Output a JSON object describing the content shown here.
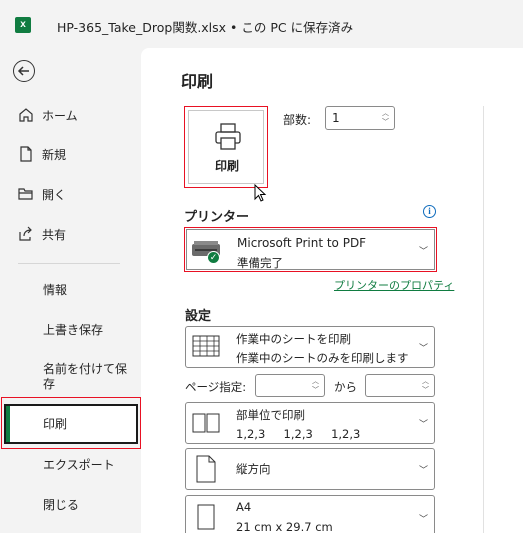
{
  "titlebar": {
    "app_icon": "excel-icon",
    "app_icon_letter": "x",
    "title": "HP-365_Take_Drop関数.xlsx • この PC に保存済み"
  },
  "sidebar": {
    "back_icon": "back-arrow-icon",
    "items": [
      {
        "label": "ホーム",
        "icon": "home-icon"
      },
      {
        "label": "新規",
        "icon": "new-file-icon"
      },
      {
        "label": "開く",
        "icon": "folder-icon"
      },
      {
        "label": "共有",
        "icon": "share-icon"
      }
    ],
    "plain_items": [
      "情報",
      "上書き保存",
      "名前を付けて保存",
      "印刷",
      "エクスポート",
      "閉じる"
    ],
    "active_item": "印刷",
    "accent_color": "#107c41"
  },
  "main": {
    "title": "印刷",
    "print_button_label": "印刷",
    "copies_label": "部数:",
    "copies_value": "1",
    "printer_section_title": "プリンター",
    "printer": {
      "name": "Microsoft Print to PDF",
      "status": "準備完了",
      "icon": "printer-icon"
    },
    "printer_properties_link": "プリンターのプロパティ",
    "settings_section_title": "設定",
    "settings": {
      "what": {
        "title": "作業中のシートを印刷",
        "desc": "作業中のシートのみを印刷します",
        "icon": "sheet-grid-icon"
      },
      "pages_label": "ページ指定:",
      "pages_from": "",
      "pages_to_label": "から",
      "pages_to": "",
      "collate": {
        "title": "部単位で印刷",
        "desc": "1,2,3     1,2,3     1,2,3",
        "icon": "collate-icon"
      },
      "orientation": {
        "title": "縦方向",
        "icon": "portrait-page-icon"
      },
      "paper": {
        "title": "A4",
        "desc": "21 cm x 29.7 cm",
        "icon": "paper-size-icon"
      }
    },
    "highlight_color": "#e81123"
  }
}
